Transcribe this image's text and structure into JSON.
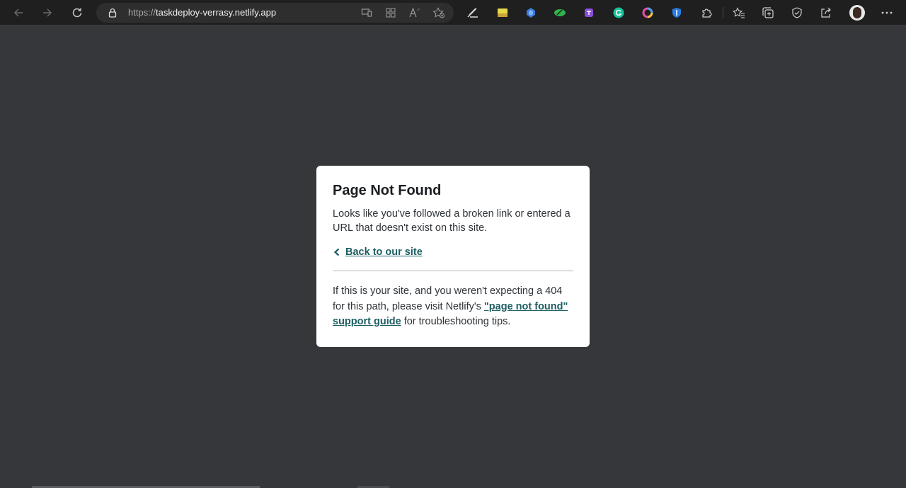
{
  "browser": {
    "url_protocol": "https://",
    "url_host": "taskdeploy-verrasy.netlify.app",
    "toolbar_icons": [
      "back-icon",
      "forward-icon",
      "refresh-icon",
      "lock-icon",
      "app-available-icon",
      "grid-icon",
      "read-aloud-icon",
      "add-favorite-icon"
    ],
    "extensions": [
      "pen-extension-icon",
      "sticky-notes-extension-icon",
      "blue-extension-icon",
      "green-extension-icon",
      "purple-extension-icon",
      "grammarly-extension-icon",
      "color-ring-extension-icon",
      "shield-extension-icon",
      "puzzle-extensions-icon",
      "favorites-icon",
      "collections-icon",
      "browser-essentials-icon",
      "share-icon",
      "profile-avatar",
      "more-menu-icon"
    ]
  },
  "page": {
    "title": "Page Not Found",
    "message": "Looks like you've followed a broken link or entered a URL that doesn't exist on this site.",
    "back_link": "Back to our site",
    "footer_pre": "If this is your site, and you weren't expecting a 404 for this path, please visit Netlify's ",
    "footer_link": "\"page not found\" support guide",
    "footer_post": " for troubleshooting tips."
  },
  "colors": {
    "background": "#35373b",
    "card": "#ffffff",
    "link": "#1d5e62",
    "toolbar": "#1f1f1f"
  }
}
